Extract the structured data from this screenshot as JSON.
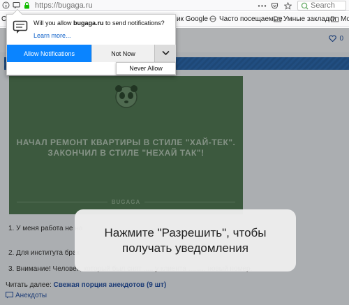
{
  "browser": {
    "url": "https://bugaga.ru",
    "search_placeholder": "Search"
  },
  "bookmarks": [
    "Ст",
    "ик Google",
    "Часто посещаемые",
    "Умные закладки",
    "Mo"
  ],
  "page": {
    "title_fragment": "Свежая порция анекдотов (9 шт)",
    "image_text_line1": "НАЧАЛ РЕМОНТ КВАРТИРЫ В СТИЛЕ \"ХАЙ-ТЕК\".",
    "image_text_line2": "ЗАКОНЧИЛ В СТИЛЕ \"НЕХАЙ ТАК\"!",
    "image_brand": "BUGAGA",
    "heart_count": "0",
    "jokes": [
      "1. У меня работа не на",
      "2. Для института брак",
      "3. Внимание! Человек, который был снят ..... у клиента ......... новый номер."
    ],
    "read_more_label": "Читать далее:",
    "read_more_link": "Свежая порция анекдотов (9 шт)",
    "footer_link": "Анекдоты"
  },
  "notification": {
    "message_prefix": "Will you allow ",
    "message_site": "bugaga.ru",
    "message_suffix": " to send notifications?",
    "learn_more": "Learn more...",
    "allow_label": "Allow Notifications",
    "not_now_label": "Not Now",
    "never_allow_label": "Never Allow"
  },
  "tooltip": {
    "line1": "Нажмите \"Разрешить\", чтобы",
    "line2": "получать уведомления"
  }
}
